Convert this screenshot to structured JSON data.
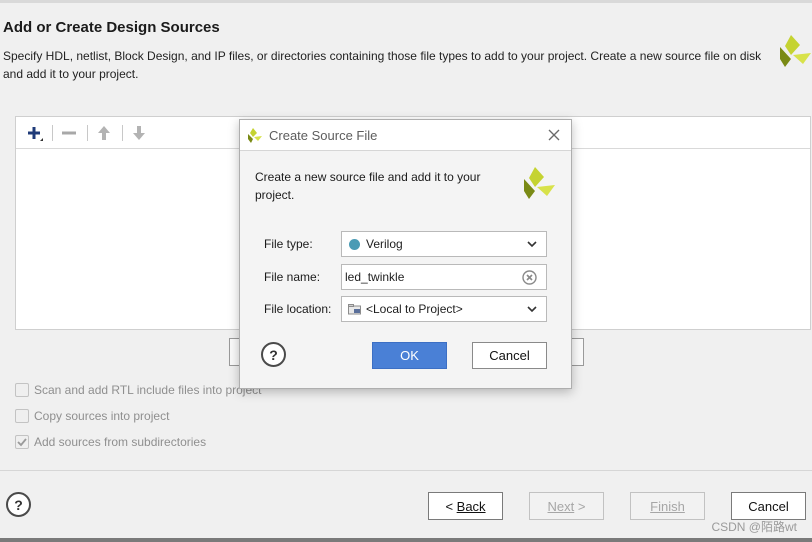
{
  "header": {
    "title": "Add or Create Design Sources",
    "description": "Specify HDL, netlist, Block Design, and IP files, or directories containing those file types to add to your project. Create a new source file on disk and add it to your project."
  },
  "file_toolbar": {
    "icons": [
      "add-icon",
      "remove-icon",
      "move-up-icon",
      "move-down-icon"
    ]
  },
  "options": [
    {
      "label": "Scan and add RTL include files into project",
      "checked": false,
      "enabled": false
    },
    {
      "label": "Copy sources into project",
      "checked": false,
      "enabled": false
    },
    {
      "label": "Add sources from subdirectories",
      "checked": true,
      "enabled": false
    }
  ],
  "footer": {
    "help": "?",
    "back_prefix": "< ",
    "back_label": "Back",
    "next_label": "Next",
    "next_suffix": " >",
    "finish_label": "Finish",
    "cancel_label": "Cancel"
  },
  "watermark": "CSDN @陌路wt",
  "dialog": {
    "title": "Create Source File",
    "description": "Create a new source file and add it to your project.",
    "file_type": {
      "label": "File type:",
      "value": "Verilog",
      "dot_color": "#4a9bb5"
    },
    "file_name": {
      "label": "File name:",
      "value": "led_twinkle"
    },
    "file_location": {
      "label": "File location:",
      "value": "<Local to Project>"
    },
    "help": "?",
    "ok_label": "OK",
    "cancel_label": "Cancel"
  },
  "colors": {
    "accent_button": "#4a80d6",
    "logo_green": "#b8c82a",
    "logo_dark": "#6f7d10"
  }
}
